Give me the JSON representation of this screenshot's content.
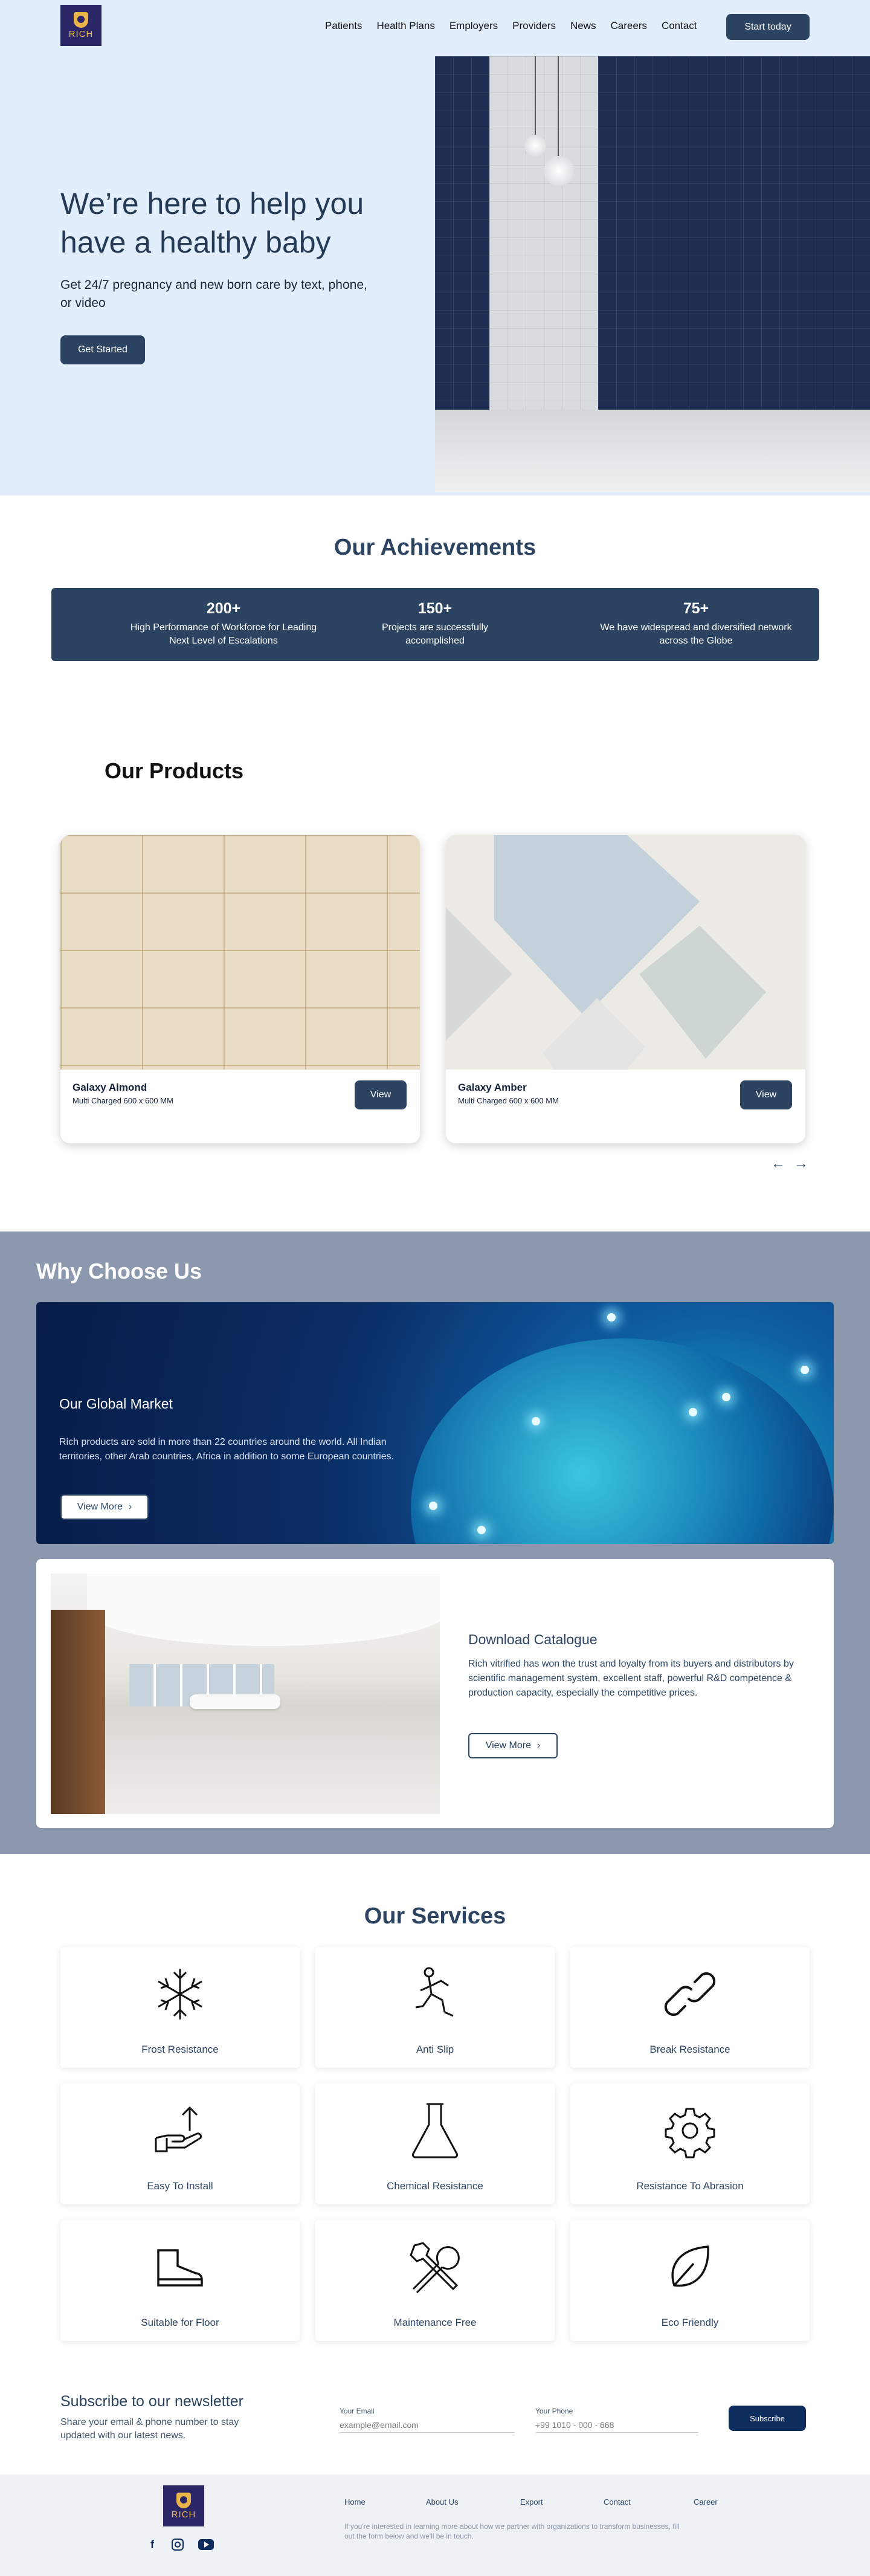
{
  "nav": {
    "logo_text": "RICH",
    "links": [
      "Patients",
      "Health Plans",
      "Employers",
      "Providers",
      "News",
      "Careers",
      "Contact"
    ],
    "cta": "Start today"
  },
  "hero": {
    "title": "We’re here to help you have a healthy baby",
    "subtitle": "Get 24/7 pregnancy and new born care by text, phone, or video",
    "button": "Get Started"
  },
  "achievements": {
    "title": "Our Achievements",
    "items": [
      {
        "value": "200+",
        "desc": "High Performance of Workforce for Leading Next Level of Escalations"
      },
      {
        "value": "150+",
        "desc": "Projects are successfully accomplished"
      },
      {
        "value": "75+",
        "desc": "We have widespread and diversified network across the Globe"
      }
    ]
  },
  "products": {
    "title": "Our Products",
    "items": [
      {
        "name": "Galaxy Almond",
        "spec": "Multi Charged 600 x 600 MM",
        "button": "View"
      },
      {
        "name": "Galaxy Amber",
        "spec": "Multi Charged 600 x 600 MM",
        "button": "View"
      }
    ],
    "prev_icon": "arrow-left-icon",
    "next_icon": "arrow-right-icon"
  },
  "why": {
    "title": "Why Choose Us",
    "global": {
      "title": "Our Global Market",
      "text": "Rich products are sold in more than 22 countries around the world. All Indian territories, other Arab countries, Africa in addition to some European countries.",
      "button": "View More"
    },
    "catalogue": {
      "title": "Download Catalogue",
      "text": "Rich vitrified has won the trust and loyalty from its buyers and distributors by scientific management system, excellent staff, powerful R&D competence & production capacity, especially the competitive prices.",
      "button": "View More"
    }
  },
  "services": {
    "title": "Our Services",
    "items": [
      {
        "label": "Frost Resistance",
        "icon": "snowflake-icon"
      },
      {
        "label": "Anti Slip",
        "icon": "slip-icon"
      },
      {
        "label": "Break Resistance",
        "icon": "link-icon"
      },
      {
        "label": "Easy To Install",
        "icon": "hand-arrow-icon"
      },
      {
        "label": "Chemical Resistance",
        "icon": "flask-icon"
      },
      {
        "label": "Resistance To Abrasion",
        "icon": "gear-icon"
      },
      {
        "label": "Suitable for Floor",
        "icon": "shoe-icon"
      },
      {
        "label": "Maintenance Free",
        "icon": "tools-icon"
      },
      {
        "label": "Eco Friendly",
        "icon": "leaf-icon"
      }
    ]
  },
  "newsletter": {
    "title": "Subscribe to our newsletter",
    "subtitle": "Share your email & phone number to stay updated with our latest news.",
    "email_label": "Your Email",
    "email_placeholder": "example@email.com",
    "phone_label": "Your Phone",
    "phone_placeholder": "+99 1010 - 000 - 668",
    "button": "Subscribe"
  },
  "footer": {
    "logo_text": "RICH",
    "links": [
      "Home",
      "About Us",
      "Export",
      "Contact",
      "Career"
    ],
    "text": "If you're interested in learning more about how we partner with organizations to transform businesses, fill out the form below and we'll be in touch.",
    "social_icons": [
      "facebook-icon",
      "instagram-icon",
      "youtube-icon"
    ]
  },
  "colors": {
    "primary": "#2c4462",
    "hero_bg": "#e3eefc",
    "why_bg": "#8b98ad",
    "accent": "#e9b44a"
  }
}
